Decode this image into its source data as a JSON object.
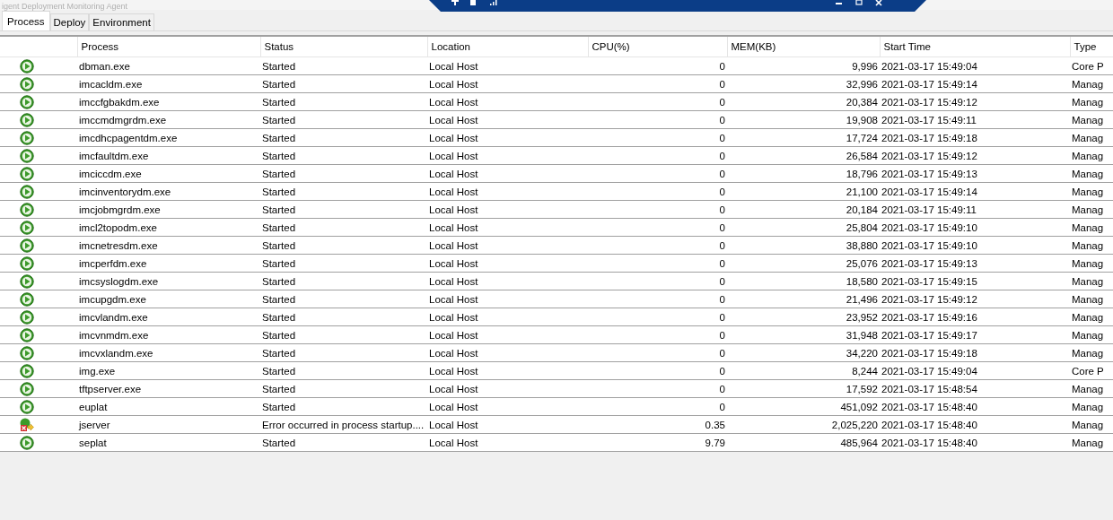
{
  "window": {
    "title": "igent Deployment Monitoring Agent"
  },
  "tabs": [
    {
      "label": "Process",
      "selected": true
    },
    {
      "label": "Deploy",
      "selected": false
    },
    {
      "label": "Environment",
      "selected": false
    }
  ],
  "table": {
    "columns": [
      "Process",
      "Status",
      "Location",
      "CPU(%)",
      "MEM(KB)",
      "Start Time",
      "Type"
    ],
    "rows": [
      {
        "kind": "running",
        "cells": [
          "dbman.exe",
          "Started",
          "Local Host",
          "0",
          "9,996",
          "2021-03-17 15:49:04",
          "Core P"
        ]
      },
      {
        "kind": "running",
        "cells": [
          "imcacldm.exe",
          "Started",
          "Local Host",
          "0",
          "32,996",
          "2021-03-17 15:49:14",
          "Manag"
        ]
      },
      {
        "kind": "running",
        "cells": [
          "imccfgbakdm.exe",
          "Started",
          "Local Host",
          "0",
          "20,384",
          "2021-03-17 15:49:12",
          "Manag"
        ]
      },
      {
        "kind": "running",
        "cells": [
          "imccmdmgrdm.exe",
          "Started",
          "Local Host",
          "0",
          "19,908",
          "2021-03-17 15:49:11",
          "Manag"
        ]
      },
      {
        "kind": "running",
        "cells": [
          "imcdhcpagentdm.exe",
          "Started",
          "Local Host",
          "0",
          "17,724",
          "2021-03-17 15:49:18",
          "Manag"
        ]
      },
      {
        "kind": "running",
        "cells": [
          "imcfaultdm.exe",
          "Started",
          "Local Host",
          "0",
          "26,584",
          "2021-03-17 15:49:12",
          "Manag"
        ]
      },
      {
        "kind": "running",
        "cells": [
          "imciccdm.exe",
          "Started",
          "Local Host",
          "0",
          "18,796",
          "2021-03-17 15:49:13",
          "Manag"
        ]
      },
      {
        "kind": "running",
        "cells": [
          "imcinventorydm.exe",
          "Started",
          "Local Host",
          "0",
          "21,100",
          "2021-03-17 15:49:14",
          "Manag"
        ]
      },
      {
        "kind": "running",
        "cells": [
          "imcjobmgrdm.exe",
          "Started",
          "Local Host",
          "0",
          "20,184",
          "2021-03-17 15:49:11",
          "Manag"
        ]
      },
      {
        "kind": "running",
        "cells": [
          "imcl2topodm.exe",
          "Started",
          "Local Host",
          "0",
          "25,804",
          "2021-03-17 15:49:10",
          "Manag"
        ]
      },
      {
        "kind": "running",
        "cells": [
          "imcnetresdm.exe",
          "Started",
          "Local Host",
          "0",
          "38,880",
          "2021-03-17 15:49:10",
          "Manag"
        ]
      },
      {
        "kind": "running",
        "cells": [
          "imcperfdm.exe",
          "Started",
          "Local Host",
          "0",
          "25,076",
          "2021-03-17 15:49:13",
          "Manag"
        ]
      },
      {
        "kind": "running",
        "cells": [
          "imcsyslogdm.exe",
          "Started",
          "Local Host",
          "0",
          "18,580",
          "2021-03-17 15:49:15",
          "Manag"
        ]
      },
      {
        "kind": "running",
        "cells": [
          "imcupgdm.exe",
          "Started",
          "Local Host",
          "0",
          "21,496",
          "2021-03-17 15:49:12",
          "Manag"
        ]
      },
      {
        "kind": "running",
        "cells": [
          "imcvlandm.exe",
          "Started",
          "Local Host",
          "0",
          "23,952",
          "2021-03-17 15:49:16",
          "Manag"
        ]
      },
      {
        "kind": "running",
        "cells": [
          "imcvnmdm.exe",
          "Started",
          "Local Host",
          "0",
          "31,948",
          "2021-03-17 15:49:17",
          "Manag"
        ]
      },
      {
        "kind": "running",
        "cells": [
          "imcvxlandm.exe",
          "Started",
          "Local Host",
          "0",
          "34,220",
          "2021-03-17 15:49:18",
          "Manag"
        ]
      },
      {
        "kind": "running",
        "cells": [
          "img.exe",
          "Started",
          "Local Host",
          "0",
          "8,244",
          "2021-03-17 15:49:04",
          "Core P"
        ]
      },
      {
        "kind": "running",
        "cells": [
          "tftpserver.exe",
          "Started",
          "Local Host",
          "0",
          "17,592",
          "2021-03-17 15:48:54",
          "Manag"
        ]
      },
      {
        "kind": "running",
        "cells": [
          "euplat",
          "Started",
          "Local Host",
          "0",
          "451,092",
          "2021-03-17 15:48:40",
          "Manag"
        ]
      },
      {
        "kind": "error",
        "cells": [
          "jserver",
          "Error occurred in process startup....",
          "Local Host",
          "0.35",
          "2,025,220",
          "2021-03-17 15:48:40",
          "Manag"
        ]
      },
      {
        "kind": "running",
        "cells": [
          "seplat",
          "Started",
          "Local Host",
          "9.79",
          "485,964",
          "2021-03-17 15:48:40",
          "Manag"
        ]
      }
    ]
  }
}
